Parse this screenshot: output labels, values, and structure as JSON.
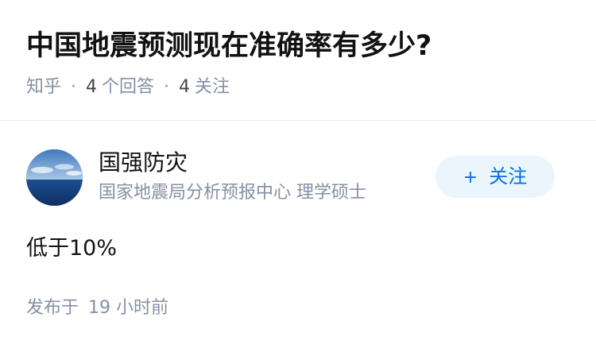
{
  "question": {
    "title": "中国地震预测现在准确率有多少?",
    "source": "知乎",
    "separator": "·",
    "answer_count": "4",
    "answer_label": "个回答",
    "follower_count": "4",
    "follower_label": "关注"
  },
  "answer": {
    "author": {
      "name": "国强防灾",
      "bio": "国家地震局分析预报中心 理学硕士",
      "avatar_icon": "ocean-horizon-avatar"
    },
    "follow_button": {
      "icon": "+",
      "label": "关注"
    },
    "content": "低于10%",
    "published": {
      "label": "发布于",
      "time": "19 小时前"
    }
  },
  "colors": {
    "title_text": "#121212",
    "meta_text": "#8590a6",
    "follow_text": "#056de8",
    "follow_bg": "#ebf5fd",
    "divider": "#ebebeb"
  }
}
